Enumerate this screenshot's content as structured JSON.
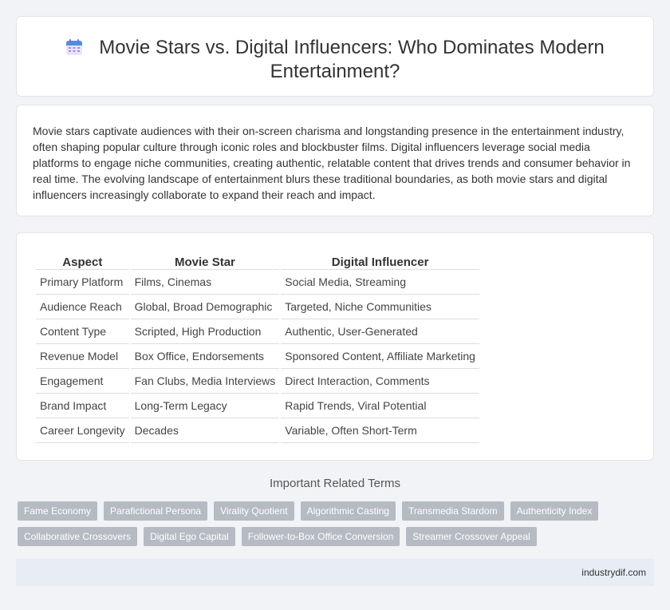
{
  "header": {
    "title": "Movie Stars vs. Digital Influencers: Who Dominates Modern Entertainment?",
    "icon": "calendar-icon"
  },
  "intro": {
    "text": "Movie stars captivate audiences with their on-screen charisma and longstanding presence in the entertainment industry, often shaping popular culture through iconic roles and blockbuster films. Digital influencers leverage social media platforms to engage niche communities, creating authentic, relatable content that drives trends and consumer behavior in real time. The evolving landscape of entertainment blurs these traditional boundaries, as both movie stars and digital influencers increasingly collaborate to expand their reach and impact."
  },
  "table": {
    "headers": [
      "Aspect",
      "Movie Star",
      "Digital Influencer"
    ],
    "rows": [
      [
        "Primary Platform",
        "Films, Cinemas",
        "Social Media, Streaming"
      ],
      [
        "Audience Reach",
        "Global, Broad Demographic",
        "Targeted, Niche Communities"
      ],
      [
        "Content Type",
        "Scripted, High Production",
        "Authentic, User-Generated"
      ],
      [
        "Revenue Model",
        "Box Office, Endorsements",
        "Sponsored Content, Affiliate Marketing"
      ],
      [
        "Engagement",
        "Fan Clubs, Media Interviews",
        "Direct Interaction, Comments"
      ],
      [
        "Brand Impact",
        "Long-Term Legacy",
        "Rapid Trends, Viral Potential"
      ],
      [
        "Career Longevity",
        "Decades",
        "Variable, Often Short-Term"
      ]
    ]
  },
  "related": {
    "heading": "Important Related Terms",
    "tags": [
      "Fame Economy",
      "Parafictional Persona",
      "Virality Quotient",
      "Algorithmic Casting",
      "Transmedia Stardom",
      "Authenticity Index",
      "Collaborative Crossovers",
      "Digital Ego Capital",
      "Follower-to-Box Office Conversion",
      "Streamer Crossover Appeal"
    ]
  },
  "footer": {
    "site": "industrydif.com"
  },
  "colors": {
    "tag_bg": "#b6bbc3",
    "page_bg": "#f1f3f6",
    "footer_bg": "#e8ecf4"
  }
}
